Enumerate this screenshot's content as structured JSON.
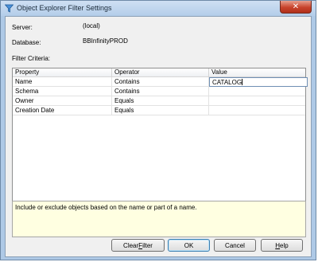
{
  "window": {
    "title": "Object Explorer Filter Settings",
    "close_glyph": "✕"
  },
  "info": {
    "server_label": "Server:",
    "server_value": "(local)",
    "database_label": "Database:",
    "database_value": "BBInfinityPROD",
    "filter_criteria_label": "Filter Criteria:"
  },
  "grid": {
    "headers": [
      "Property",
      "Operator",
      "Value"
    ],
    "rows": [
      {
        "property": "Name",
        "operator": "Contains",
        "value": "CATALOG"
      },
      {
        "property": "Schema",
        "operator": "Contains",
        "value": ""
      },
      {
        "property": "Owner",
        "operator": "Equals",
        "value": ""
      },
      {
        "property": "Creation Date",
        "operator": "Equals",
        "value": ""
      }
    ]
  },
  "description": "Include or exclude objects based on the name or part of a name.",
  "buttons": {
    "clear_filter_a": "Clear ",
    "clear_filter_u": "F",
    "clear_filter_b": "ilter",
    "ok": "OK",
    "cancel": "Cancel",
    "help_u": "H",
    "help_b": "elp"
  },
  "colors": {
    "frame": "#aec9e6",
    "description_bg": "#ffffe1",
    "close_button": "#c8432c"
  },
  "icons": {
    "title": "filter-funnel-icon"
  }
}
